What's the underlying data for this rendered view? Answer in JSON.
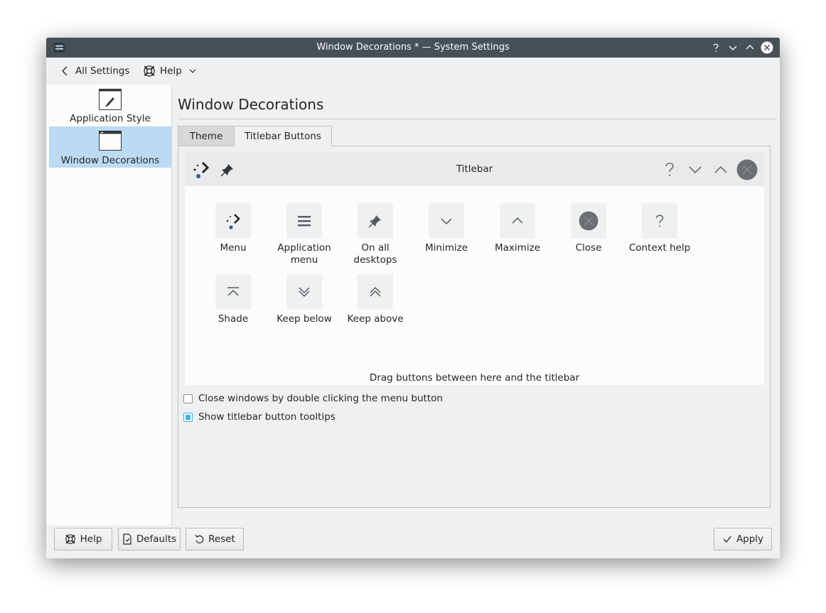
{
  "window": {
    "title": "Window Decorations * — System Settings"
  },
  "toolbar": {
    "back_label": "All Settings",
    "help_label": "Help"
  },
  "sidebar": {
    "items": [
      {
        "label": "Application Style",
        "selected": false,
        "icon": "application-style-icon"
      },
      {
        "label": "Window Decorations",
        "selected": true,
        "icon": "window-decorations-icon"
      }
    ]
  },
  "page": {
    "title": "Window Decorations"
  },
  "tabs": [
    {
      "label": "Theme",
      "active": false
    },
    {
      "label": "Titlebar Buttons",
      "active": true
    }
  ],
  "preview": {
    "label": "Titlebar"
  },
  "palette": {
    "items": [
      {
        "label": "Menu",
        "icon": "menu-dots-icon"
      },
      {
        "label": "Application menu",
        "icon": "hamburger-icon"
      },
      {
        "label": "On all desktops",
        "icon": "pin-icon"
      },
      {
        "label": "Minimize",
        "icon": "chevron-down-icon"
      },
      {
        "label": "Maximize",
        "icon": "chevron-up-icon"
      },
      {
        "label": "Close",
        "icon": "close-circle-icon"
      },
      {
        "label": "Context help",
        "icon": "question-icon"
      },
      {
        "label": "Shade",
        "icon": "shade-icon"
      },
      {
        "label": "Keep below",
        "icon": "double-chevron-down-icon"
      },
      {
        "label": "Keep above",
        "icon": "double-chevron-up-icon"
      }
    ],
    "hint": "Drag buttons between here and the titlebar"
  },
  "options": {
    "close_double_click": {
      "label": "Close windows by double clicking the menu button",
      "checked": false
    },
    "show_tooltips": {
      "label": "Show titlebar button tooltips",
      "checked": true
    }
  },
  "buttons": {
    "help": "Help",
    "defaults": "Defaults",
    "reset": "Reset",
    "apply": "Apply"
  },
  "colors": {
    "accent": "#3daee9",
    "titlebar": "#475057",
    "selection": "#bcdaf2",
    "close_grey": "#6b6f72"
  }
}
